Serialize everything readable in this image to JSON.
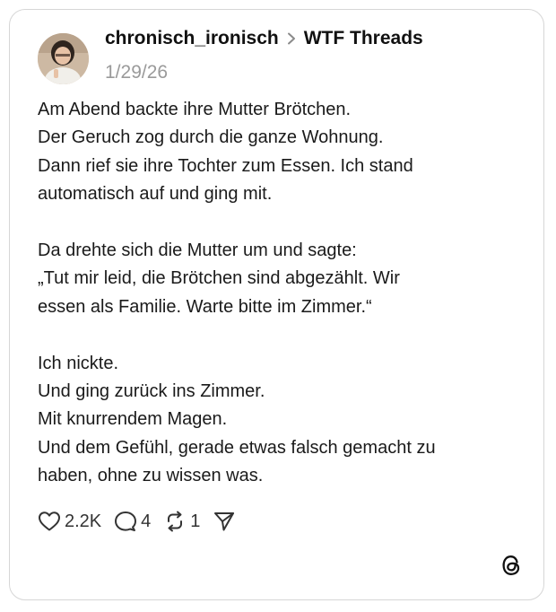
{
  "post": {
    "author": "chronisch_ironisch",
    "community": "WTF Threads",
    "date": "1/29/26",
    "paragraphs": [
      [
        "Am Abend backte ihre Mutter Brötchen.",
        "Der Geruch zog durch die ganze Wohnung.",
        "Dann rief sie ihre Tochter zum Essen. Ich stand",
        "automatisch auf und ging mit."
      ],
      [
        "Da drehte sich die Mutter um und sagte:",
        "„Tut mir leid, die Brötchen sind abgezählt. Wir",
        "essen als Familie. Warte bitte im Zimmer.“"
      ],
      [
        "Ich nickte.",
        "Und ging zurück ins Zimmer.",
        "Mit knurrendem Magen.",
        "Und dem Gefühl, gerade etwas falsch gemacht zu",
        "haben, ohne zu wissen was."
      ]
    ]
  },
  "actions": {
    "likes": "2.2K",
    "replies": "4",
    "reposts": "1"
  },
  "icons": {
    "like": "heart-icon",
    "reply": "comment-bubble-icon",
    "repost": "repost-icon",
    "share": "send-icon",
    "brand": "threads-logo-icon"
  },
  "colors": {
    "text": "#1a1a1a",
    "muted": "#9a9a9a",
    "border": "#d6d6d6"
  }
}
